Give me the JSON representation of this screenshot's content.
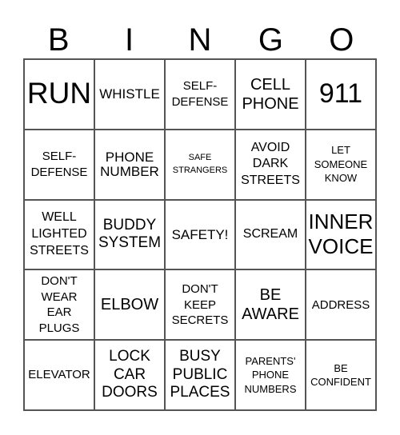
{
  "header": {
    "letters": [
      "B",
      "I",
      "N",
      "G",
      "O"
    ]
  },
  "board": {
    "cells": [
      "RUN",
      "WHISTLE",
      "SELF-\nDEFENSE",
      "CELL\nPHONE",
      "911",
      "SELF-\nDEFENSE",
      "PHONE\nNUMBER",
      "SAFE\nSTRANGERS",
      "AVOID\nDARK\nSTREETS",
      "LET\nSOMEONE\nKNOW",
      "WELL\nLIGHTED\nSTREETS",
      "BUDDY\nSYSTEM",
      "SAFETY!",
      "SCREAM",
      "INNER\nVOICE",
      "DON'T\nWEAR\nEAR\nPLUGS",
      "ELBOW",
      "DON'T\nKEEP\nSECRETS",
      "BE\nAWARE",
      "ADDRESS",
      "ELEVATOR",
      "LOCK\nCAR\nDOORS",
      "BUSY\nPUBLIC\nPLACES",
      "PARENTS'\nPHONE\nNUMBERS",
      "BE\nCONFIDENT"
    ]
  }
}
